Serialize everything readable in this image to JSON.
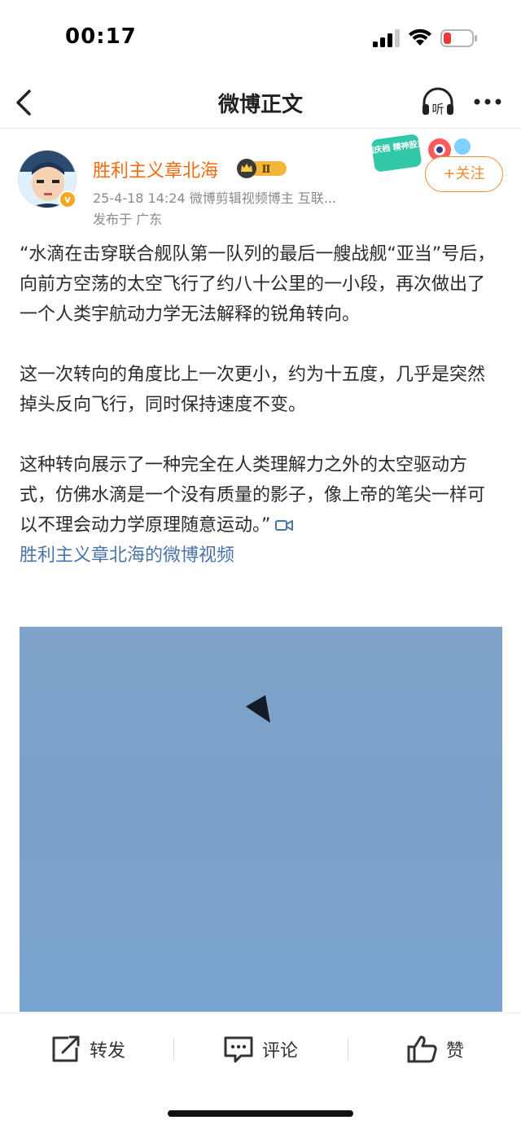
{
  "status_bar": {
    "time": "00:17"
  },
  "nav": {
    "title": "微博正文",
    "listen_label": "听"
  },
  "author": {
    "name": "胜利主义章北海",
    "vip_level": "Ⅱ",
    "meta": "25-4-18 14:24  微博剪辑视频博主 互联...",
    "location": "发布于 广东",
    "follow_label": "+关注",
    "verified_mark": "v",
    "sticker_text": "国庆档 精神股东"
  },
  "post": {
    "paragraphs": [
      "“水滴在击穿联合舰队第一队列的最后一艘战舰“亚当”号后，向前方空荡的太空飞行了约八十公里的一小段，再次做出了一个人类宇航动力学无法解释的锐角转向。",
      "这一次转向的角度比上一次更小，约为十五度，几乎是突然掉头反向飞行，同时保持速度不变。",
      "这种转向展示了一种完全在人类理解力之外的太空驱动方式，仿佛水滴是一个没有质量的影子，像上帝的笔尖一样可以不理会动力学原理随意运动。”"
    ],
    "video_link": "胜利主义章北海的微博视频"
  },
  "actions": {
    "repost": "转发",
    "comment": "评论",
    "like": "赞"
  },
  "colors": {
    "accent": "#f26a0f",
    "link": "#4a74a8",
    "sky": "#7ea2c8"
  }
}
